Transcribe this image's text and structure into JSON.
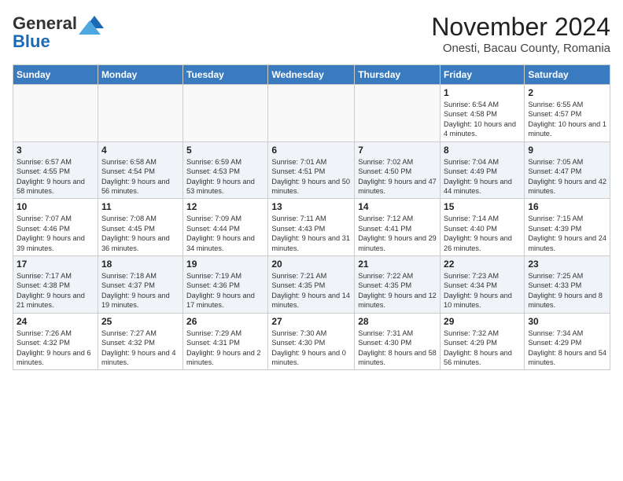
{
  "logo": {
    "general": "General",
    "blue": "Blue"
  },
  "title": "November 2024",
  "location": "Onesti, Bacau County, Romania",
  "headers": [
    "Sunday",
    "Monday",
    "Tuesday",
    "Wednesday",
    "Thursday",
    "Friday",
    "Saturday"
  ],
  "weeks": [
    [
      {
        "day": "",
        "info": ""
      },
      {
        "day": "",
        "info": ""
      },
      {
        "day": "",
        "info": ""
      },
      {
        "day": "",
        "info": ""
      },
      {
        "day": "",
        "info": ""
      },
      {
        "day": "1",
        "info": "Sunrise: 6:54 AM\nSunset: 4:58 PM\nDaylight: 10 hours and 4 minutes."
      },
      {
        "day": "2",
        "info": "Sunrise: 6:55 AM\nSunset: 4:57 PM\nDaylight: 10 hours and 1 minute."
      }
    ],
    [
      {
        "day": "3",
        "info": "Sunrise: 6:57 AM\nSunset: 4:55 PM\nDaylight: 9 hours and 58 minutes."
      },
      {
        "day": "4",
        "info": "Sunrise: 6:58 AM\nSunset: 4:54 PM\nDaylight: 9 hours and 56 minutes."
      },
      {
        "day": "5",
        "info": "Sunrise: 6:59 AM\nSunset: 4:53 PM\nDaylight: 9 hours and 53 minutes."
      },
      {
        "day": "6",
        "info": "Sunrise: 7:01 AM\nSunset: 4:51 PM\nDaylight: 9 hours and 50 minutes."
      },
      {
        "day": "7",
        "info": "Sunrise: 7:02 AM\nSunset: 4:50 PM\nDaylight: 9 hours and 47 minutes."
      },
      {
        "day": "8",
        "info": "Sunrise: 7:04 AM\nSunset: 4:49 PM\nDaylight: 9 hours and 44 minutes."
      },
      {
        "day": "9",
        "info": "Sunrise: 7:05 AM\nSunset: 4:47 PM\nDaylight: 9 hours and 42 minutes."
      }
    ],
    [
      {
        "day": "10",
        "info": "Sunrise: 7:07 AM\nSunset: 4:46 PM\nDaylight: 9 hours and 39 minutes."
      },
      {
        "day": "11",
        "info": "Sunrise: 7:08 AM\nSunset: 4:45 PM\nDaylight: 9 hours and 36 minutes."
      },
      {
        "day": "12",
        "info": "Sunrise: 7:09 AM\nSunset: 4:44 PM\nDaylight: 9 hours and 34 minutes."
      },
      {
        "day": "13",
        "info": "Sunrise: 7:11 AM\nSunset: 4:43 PM\nDaylight: 9 hours and 31 minutes."
      },
      {
        "day": "14",
        "info": "Sunrise: 7:12 AM\nSunset: 4:41 PM\nDaylight: 9 hours and 29 minutes."
      },
      {
        "day": "15",
        "info": "Sunrise: 7:14 AM\nSunset: 4:40 PM\nDaylight: 9 hours and 26 minutes."
      },
      {
        "day": "16",
        "info": "Sunrise: 7:15 AM\nSunset: 4:39 PM\nDaylight: 9 hours and 24 minutes."
      }
    ],
    [
      {
        "day": "17",
        "info": "Sunrise: 7:17 AM\nSunset: 4:38 PM\nDaylight: 9 hours and 21 minutes."
      },
      {
        "day": "18",
        "info": "Sunrise: 7:18 AM\nSunset: 4:37 PM\nDaylight: 9 hours and 19 minutes."
      },
      {
        "day": "19",
        "info": "Sunrise: 7:19 AM\nSunset: 4:36 PM\nDaylight: 9 hours and 17 minutes."
      },
      {
        "day": "20",
        "info": "Sunrise: 7:21 AM\nSunset: 4:35 PM\nDaylight: 9 hours and 14 minutes."
      },
      {
        "day": "21",
        "info": "Sunrise: 7:22 AM\nSunset: 4:35 PM\nDaylight: 9 hours and 12 minutes."
      },
      {
        "day": "22",
        "info": "Sunrise: 7:23 AM\nSunset: 4:34 PM\nDaylight: 9 hours and 10 minutes."
      },
      {
        "day": "23",
        "info": "Sunrise: 7:25 AM\nSunset: 4:33 PM\nDaylight: 9 hours and 8 minutes."
      }
    ],
    [
      {
        "day": "24",
        "info": "Sunrise: 7:26 AM\nSunset: 4:32 PM\nDaylight: 9 hours and 6 minutes."
      },
      {
        "day": "25",
        "info": "Sunrise: 7:27 AM\nSunset: 4:32 PM\nDaylight: 9 hours and 4 minutes."
      },
      {
        "day": "26",
        "info": "Sunrise: 7:29 AM\nSunset: 4:31 PM\nDaylight: 9 hours and 2 minutes."
      },
      {
        "day": "27",
        "info": "Sunrise: 7:30 AM\nSunset: 4:30 PM\nDaylight: 9 hours and 0 minutes."
      },
      {
        "day": "28",
        "info": "Sunrise: 7:31 AM\nSunset: 4:30 PM\nDaylight: 8 hours and 58 minutes."
      },
      {
        "day": "29",
        "info": "Sunrise: 7:32 AM\nSunset: 4:29 PM\nDaylight: 8 hours and 56 minutes."
      },
      {
        "day": "30",
        "info": "Sunrise: 7:34 AM\nSunset: 4:29 PM\nDaylight: 8 hours and 54 minutes."
      }
    ]
  ]
}
